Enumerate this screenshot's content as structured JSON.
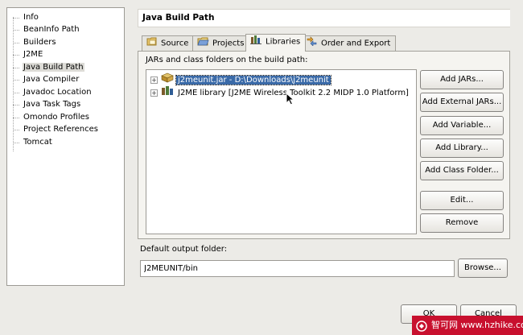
{
  "tree": {
    "items": [
      {
        "label": "Info",
        "selected": false
      },
      {
        "label": "BeanInfo Path",
        "selected": false
      },
      {
        "label": "Builders",
        "selected": false
      },
      {
        "label": "J2ME",
        "selected": false
      },
      {
        "label": "Java Build Path",
        "selected": true
      },
      {
        "label": "Java Compiler",
        "selected": false
      },
      {
        "label": "Javadoc Location",
        "selected": false
      },
      {
        "label": "Java Task Tags",
        "selected": false
      },
      {
        "label": "Omondo Profiles",
        "selected": false
      },
      {
        "label": "Project References",
        "selected": false
      },
      {
        "label": "Tomcat",
        "selected": false
      }
    ]
  },
  "page_title": "Java Build Path",
  "tabs": [
    {
      "label": "Source",
      "icon": "source-folder-icon",
      "active": false
    },
    {
      "label": "Projects",
      "icon": "projects-icon",
      "active": false
    },
    {
      "label": "Libraries",
      "icon": "libraries-icon",
      "active": true
    },
    {
      "label": "Order and Export",
      "icon": "order-export-icon",
      "active": false
    }
  ],
  "libraries": {
    "list_label": "JARs and class folders on the build path:",
    "entries": [
      {
        "label": "j2meunit.jar - D:\\Downloads\\j2meunit",
        "icon": "jar-icon",
        "selected": true
      },
      {
        "label": "J2ME library [J2ME Wireless Toolkit 2.2 MIDP 1.0 Platform]",
        "icon": "library-icon",
        "selected": false
      }
    ],
    "buttons": {
      "add_jars": "Add JARs...",
      "add_external_jars": "Add External JARs...",
      "add_variable": "Add Variable...",
      "add_library": "Add Library...",
      "add_class_folder": "Add Class Folder...",
      "edit": "Edit...",
      "remove": "Remove"
    }
  },
  "output": {
    "label": "Default output folder:",
    "value": "J2MEUNIT/bin",
    "browse": "Browse..."
  },
  "dialog_buttons": {
    "ok": "OK",
    "cancel": "Cancel"
  },
  "watermark": {
    "text": "智可网 www.hzhike.com"
  },
  "colors": {
    "background": "#ecebe7",
    "selection": "#3a6aa8",
    "watermark": "#c8102e"
  }
}
